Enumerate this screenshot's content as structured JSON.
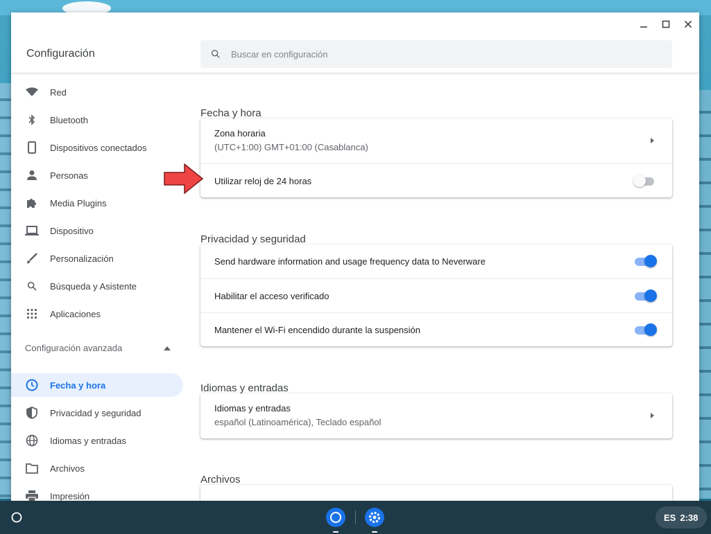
{
  "window": {
    "app_title": "Configuración",
    "minimize_icon": "minimize-icon",
    "maximize_icon": "maximize-icon",
    "close_icon": "close-icon"
  },
  "search": {
    "placeholder": "Buscar en configuración",
    "icon": "search-icon"
  },
  "sidebar": {
    "items": [
      {
        "label": "Red",
        "icon": "wifi-icon"
      },
      {
        "label": "Bluetooth",
        "icon": "bluetooth-icon"
      },
      {
        "label": "Dispositivos conectados",
        "icon": "phone-icon"
      },
      {
        "label": "Personas",
        "icon": "person-icon"
      },
      {
        "label": "Media Plugins",
        "icon": "puzzle-icon"
      },
      {
        "label": "Dispositivo",
        "icon": "laptop-icon"
      },
      {
        "label": "Personalización",
        "icon": "brush-icon"
      },
      {
        "label": "Búsqueda y Asistente",
        "icon": "search-icon"
      },
      {
        "label": "Aplicaciones",
        "icon": "apps-grid-icon"
      }
    ],
    "advanced_label": "Configuración avanzada",
    "advanced_items": [
      {
        "label": "Fecha y hora",
        "icon": "clock-icon",
        "active": true
      },
      {
        "label": "Privacidad y seguridad",
        "icon": "shield-icon"
      },
      {
        "label": "Idiomas y entradas",
        "icon": "globe-icon"
      },
      {
        "label": "Archivos",
        "icon": "folder-icon"
      },
      {
        "label": "Impresión",
        "icon": "printer-icon"
      }
    ]
  },
  "main": {
    "date_section": {
      "title": "Fecha y hora",
      "timezone_title": "Zona horaria",
      "timezone_value": "(UTC+1:00) GMT+01:00 (Casablanca)",
      "clock24_label": "Utilizar reloj de 24 horas",
      "clock24_on": false
    },
    "privacy_section": {
      "title": "Privacidad y seguridad",
      "rows": [
        {
          "label": "Send hardware information and usage frequency data to Neverware",
          "on": true
        },
        {
          "label": "Habilitar el acceso verificado",
          "on": true
        },
        {
          "label": "Mantener el Wi-Fi encendido durante la suspensión",
          "on": true
        }
      ]
    },
    "language_section": {
      "title": "Idiomas y entradas",
      "row_title": "Idiomas y entradas",
      "row_value": "español (Latinoamérica), Teclado español"
    },
    "files_section": {
      "title": "Archivos"
    }
  },
  "shelf": {
    "launcher_icon": "launcher-circle-icon",
    "apps": [
      {
        "name": "chrome-icon",
        "color": "#1a73e8"
      },
      {
        "name": "settings-gear-icon",
        "color": "#1a73e8"
      }
    ],
    "tray_lang": "ES",
    "tray_time": "2:38"
  },
  "colors": {
    "accent": "#1a73e8",
    "active_bg": "#e8f0fe",
    "pointer_arrow": "#ef4444"
  }
}
